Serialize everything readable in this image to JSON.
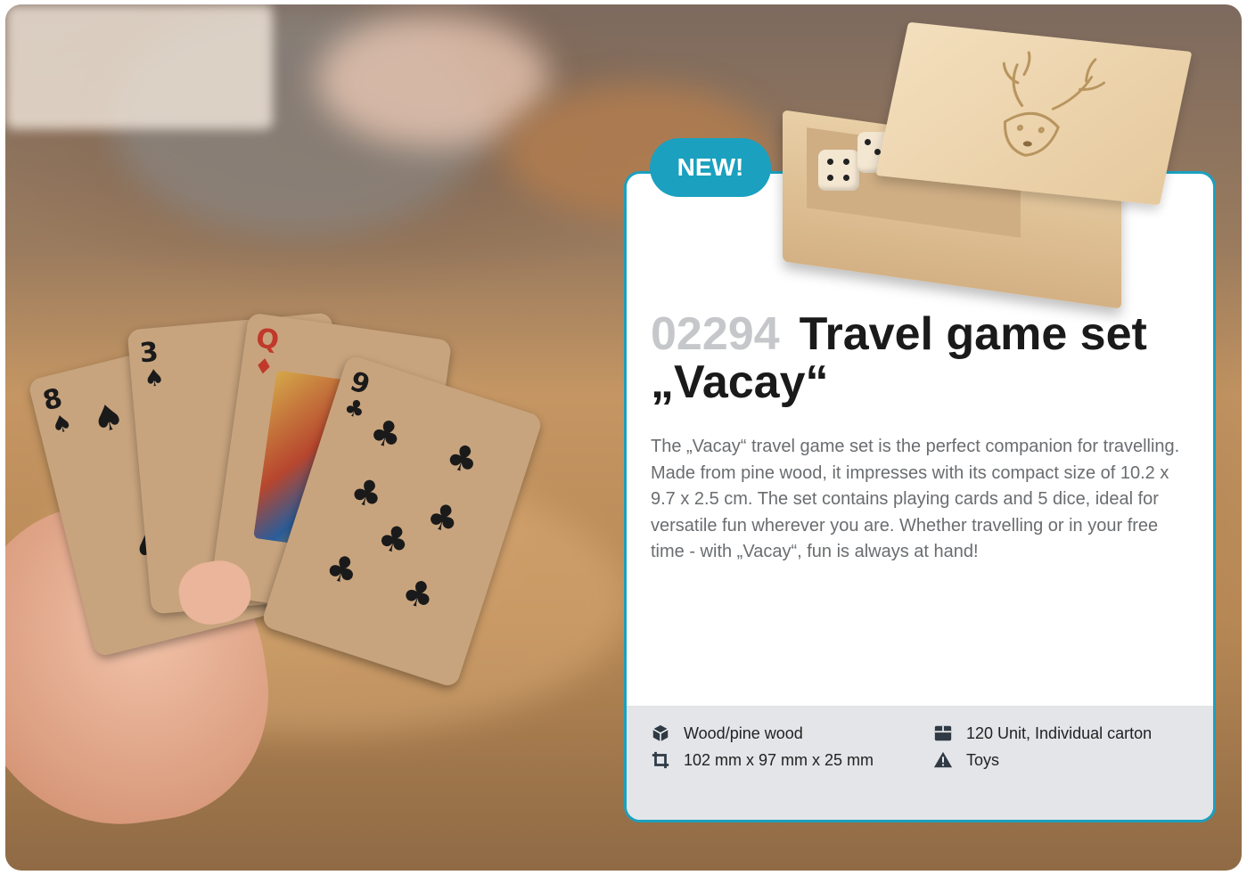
{
  "badge": {
    "label": "NEW!"
  },
  "product": {
    "number": "02294",
    "title_line1": "Travel game set",
    "title_line2": "„Vacay“",
    "description": "The „Vacay“ travel game set is the perfect companion for travelling. Made from pine wood, it impresses with its compact size of 10.2 x 9.7 x 2.5 cm. The set contains playing cards and 5 dice, ideal for versatile fun wherever you are. Whether travelling or in your free time - with „Vacay“, fun is always at hand!"
  },
  "specs": {
    "material": {
      "icon": "cube-icon",
      "text": "Wood/pine wood"
    },
    "dimensions": {
      "icon": "crop-icon",
      "text": "102 mm x 97 mm x 25 mm"
    },
    "packaging": {
      "icon": "carton-box-icon",
      "text": "120 Unit, Individual carton"
    },
    "category": {
      "icon": "warning-triangle-icon",
      "text": "Toys"
    }
  },
  "cards_in_hand": [
    "8",
    "3",
    "Q",
    "9"
  ],
  "colors": {
    "accent": "#1ba0bf",
    "footer": "#e3e5e8",
    "number": "#c5c7ca"
  }
}
